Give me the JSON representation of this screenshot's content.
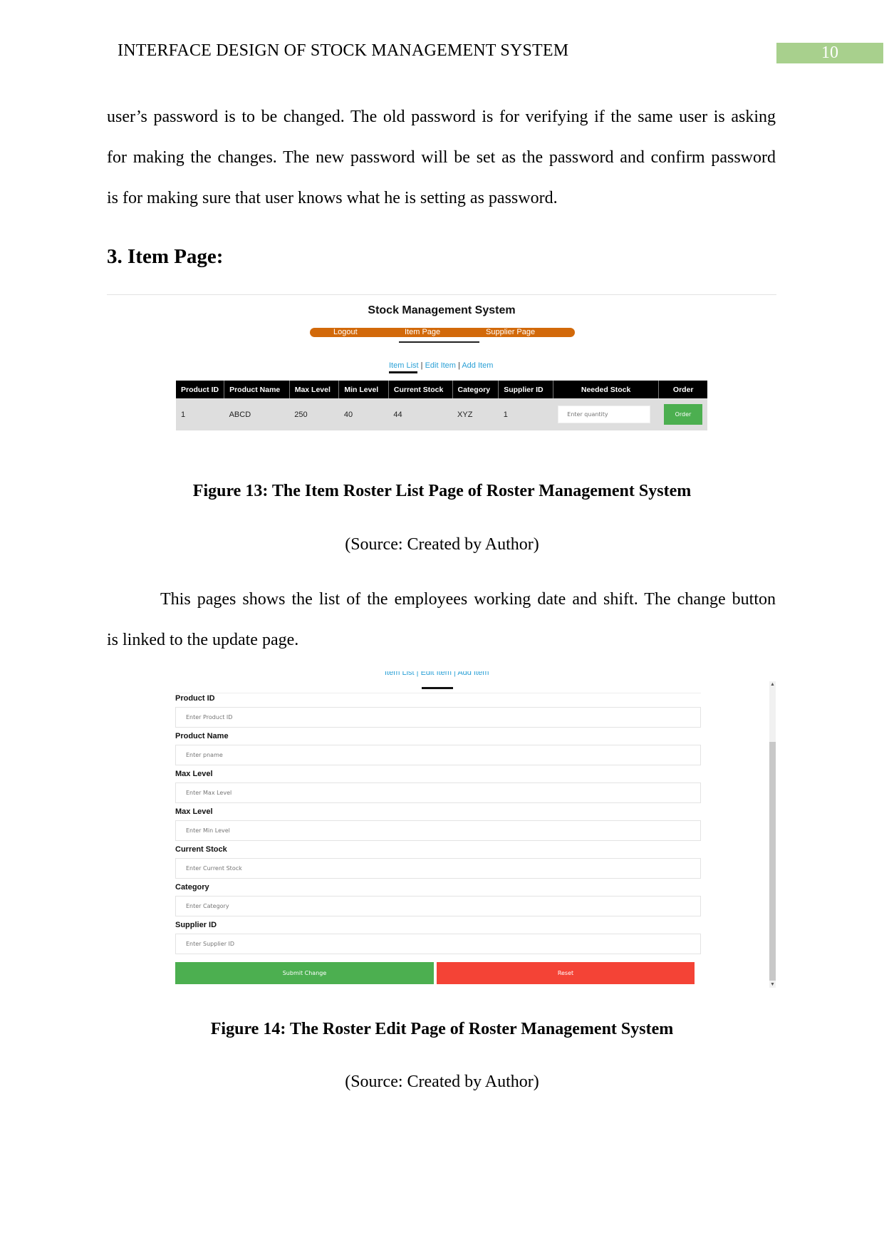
{
  "header": {
    "running_title": "INTERFACE DESIGN OF STOCK MANAGEMENT SYSTEM",
    "page_number": "10",
    "page_number_color": "#a8d08d"
  },
  "intro_paragraph": {
    "lines": [
      "user’s password is to be changed. The old password is for verifying if the same user is asking",
      "for making the changes. The new password will be set as the password and confirm password",
      "is for making sure that user knows what he is setting as password."
    ]
  },
  "section_heading": "3. Item Page:",
  "figure13": {
    "app_title": "Stock Management System",
    "nav": {
      "color": "#d2690a",
      "items": [
        "Logout",
        "Item Page",
        "Supplier Page"
      ]
    },
    "subnav": {
      "items": [
        "Item List",
        "Edit Item",
        "Add Item"
      ],
      "separator": "|",
      "active": "Item List"
    },
    "table": {
      "columns": [
        "Product ID",
        "Product Name",
        "Max Level",
        "Min Level",
        "Current Stock",
        "Category",
        "Supplier ID",
        "Needed Stock",
        "Order"
      ],
      "rows": [
        {
          "product_id": "1",
          "product_name": "ABCD",
          "max_level": "250",
          "min_level": "40",
          "current_stock": "44",
          "category": "XYZ",
          "supplier_id": "1",
          "needed_stock_placeholder": "Enter quantity",
          "order_label": "Order"
        }
      ]
    },
    "caption": "Figure 13: The Item Roster List Page of Roster Management System",
    "source": "(Source: Created by Author)"
  },
  "body_paragraph": {
    "lines": [
      "This pages shows the list of the employees working date and shift. The change button",
      "is linked to the update page."
    ]
  },
  "figure14": {
    "subnav": {
      "items": [
        "Item List",
        "Edit Item",
        "Add Item"
      ],
      "separator": "|",
      "active": "Edit Item"
    },
    "fields": [
      {
        "label": "Product ID",
        "placeholder": "Enter Product ID"
      },
      {
        "label": "Product Name",
        "placeholder": "Enter pname"
      },
      {
        "label": "Max Level",
        "placeholder": "Enter Max Level"
      },
      {
        "label": "Max Level",
        "placeholder": "Enter Min Level"
      },
      {
        "label": "Current Stock",
        "placeholder": "Enter Current Stock"
      },
      {
        "label": "Category",
        "placeholder": "Enter Category"
      },
      {
        "label": "Supplier ID",
        "placeholder": "Enter Supplier ID"
      }
    ],
    "buttons": {
      "submit": "Submit Change",
      "reset": "Reset",
      "submit_color": "#4caf50",
      "reset_color": "#f44336"
    },
    "caption": "Figure 14: The Roster Edit Page of Roster Management System",
    "source": "(Source: Created by Author)"
  }
}
